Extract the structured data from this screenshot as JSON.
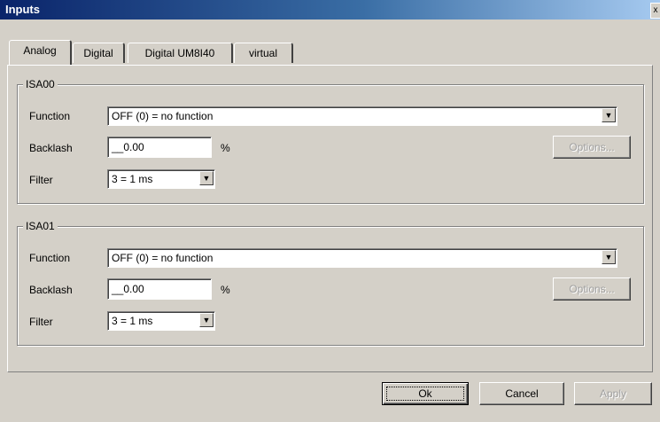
{
  "window": {
    "title": "Inputs",
    "close_label": "x"
  },
  "tabs": [
    "Analog",
    "Digital",
    "Digital UM8I40",
    "virtual"
  ],
  "groups": [
    {
      "name": "ISA00",
      "function_label": "Function",
      "function_value": "OFF (0) = no function",
      "backlash_label": "Backlash",
      "backlash_value": "__0.00",
      "backlash_unit": "%",
      "filter_label": "Filter",
      "filter_value": "3 = 1 ms",
      "options_label": "Options..."
    },
    {
      "name": "ISA01",
      "function_label": "Function",
      "function_value": "OFF (0) = no function",
      "backlash_label": "Backlash",
      "backlash_value": "__0.00",
      "backlash_unit": "%",
      "filter_label": "Filter",
      "filter_value": "3 = 1 ms",
      "options_label": "Options..."
    }
  ],
  "buttons": {
    "ok": "Ok",
    "cancel": "Cancel",
    "apply": "Apply"
  },
  "colors": {
    "titlebar_start": "#0a246a",
    "titlebar_end": "#a6caf0",
    "face": "#d4d0c8"
  }
}
